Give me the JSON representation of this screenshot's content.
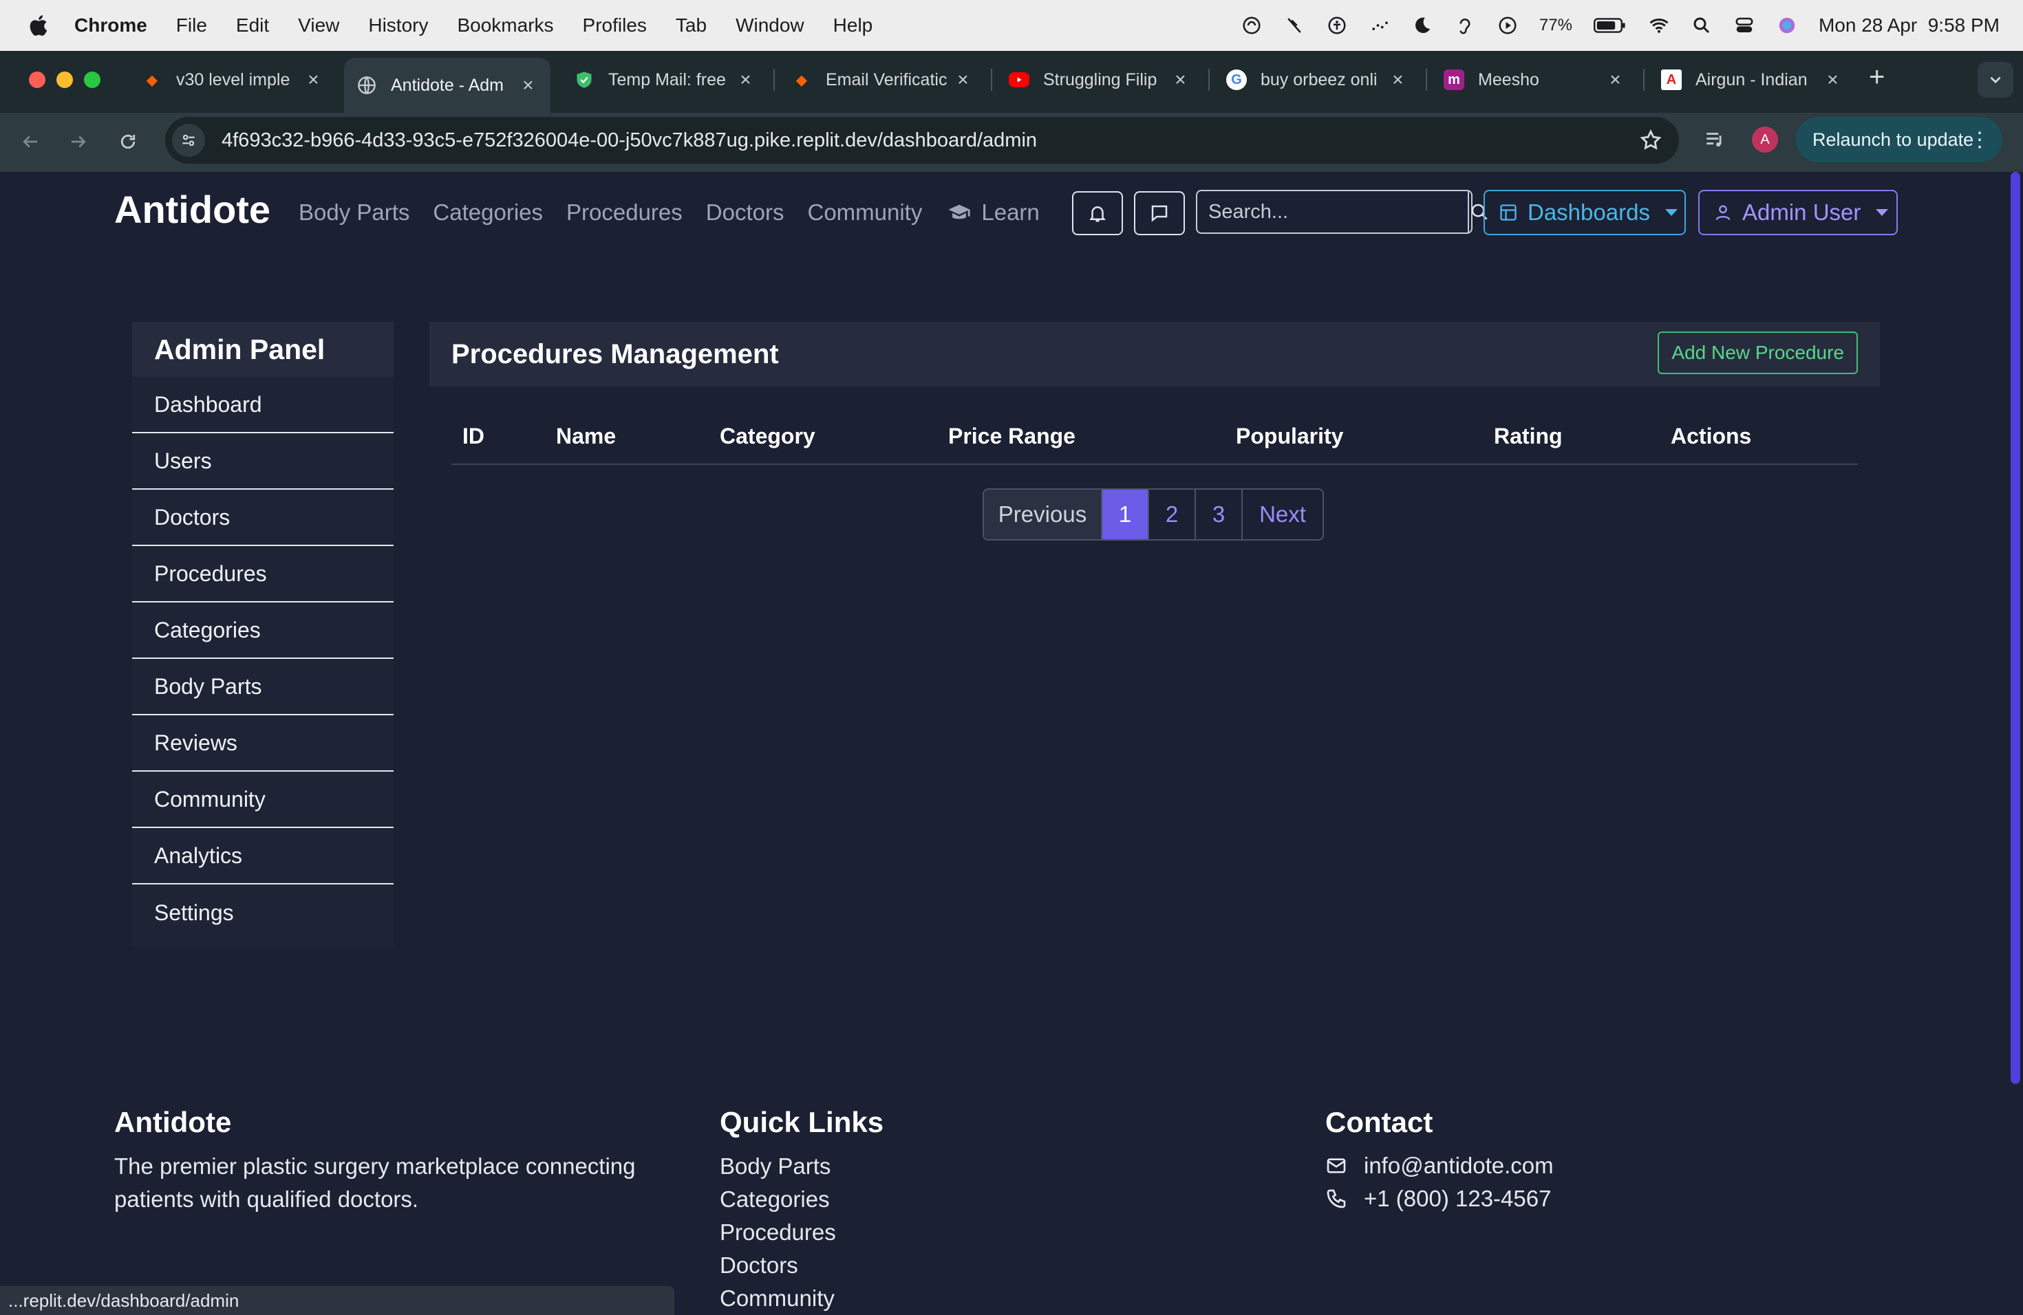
{
  "menubar": {
    "app": "Chrome",
    "items": [
      "File",
      "Edit",
      "View",
      "History",
      "Bookmarks",
      "Profiles",
      "Tab",
      "Window",
      "Help"
    ],
    "battery": "77%",
    "datetime": "Mon 28 Apr  9:58 PM"
  },
  "tabs": [
    {
      "title": "v30 level imple",
      "icon": "replit-icon",
      "color": "#f26207"
    },
    {
      "title": "Antidote - Adm",
      "icon": "globe-icon",
      "color": "#8ab4f8"
    },
    {
      "title": "Temp Mail: free",
      "icon": "shield-icon",
      "color": "#3dbe6b"
    },
    {
      "title": "Email Verificatic",
      "icon": "replit-icon",
      "color": "#f26207"
    },
    {
      "title": "Struggling Filip",
      "icon": "youtube-icon",
      "color": "#ff0000"
    },
    {
      "title": "buy orbeez onli",
      "icon": "google-icon",
      "color": "#ffffff"
    },
    {
      "title": "Meesho",
      "icon": "meesho-icon",
      "color": "#9f2089"
    },
    {
      "title": "Airgun - Indian",
      "icon": "airgun-icon",
      "color": "#e02020"
    }
  ],
  "browser": {
    "url": "4f693c32-b966-4d33-93c5-e752f326004e-00-j50vc7k887ug.pike.replit.dev/dashboard/admin",
    "relaunch": "Relaunch to update",
    "profile_initial": "A",
    "status_url": "...replit.dev/dashboard/admin"
  },
  "site": {
    "brand": "Antidote",
    "nav": [
      "Body Parts",
      "Categories",
      "Procedures",
      "Doctors",
      "Community"
    ],
    "learn": "Learn",
    "search_placeholder": "Search...",
    "dashboards": "Dashboards",
    "admin_user": "Admin User"
  },
  "sidebar": {
    "title": "Admin Panel",
    "items": [
      "Dashboard",
      "Users",
      "Doctors",
      "Procedures",
      "Categories",
      "Body Parts",
      "Reviews",
      "Community",
      "Analytics",
      "Settings"
    ]
  },
  "main": {
    "title": "Procedures Management",
    "add_button": "Add New Procedure",
    "columns": [
      "ID",
      "Name",
      "Category",
      "Price Range",
      "Popularity",
      "Rating",
      "Actions"
    ],
    "pagination": {
      "previous": "Previous",
      "pages": [
        "1",
        "2",
        "3"
      ],
      "next": "Next",
      "active": "1"
    }
  },
  "footer": {
    "brand": "Antidote",
    "tagline": "The premier plastic surgery marketplace connecting patients with qualified doctors.",
    "quick_links_title": "Quick Links",
    "quick_links": [
      "Body Parts",
      "Categories",
      "Procedures",
      "Doctors",
      "Community"
    ],
    "contact_title": "Contact",
    "email": "info@antidote.com",
    "phone": "+1 (800) 123-4567"
  },
  "colors": {
    "page_bg": "#1b2032",
    "accent": "#6c5ce7",
    "success": "#3fbf74",
    "info": "#3ea8d8"
  }
}
